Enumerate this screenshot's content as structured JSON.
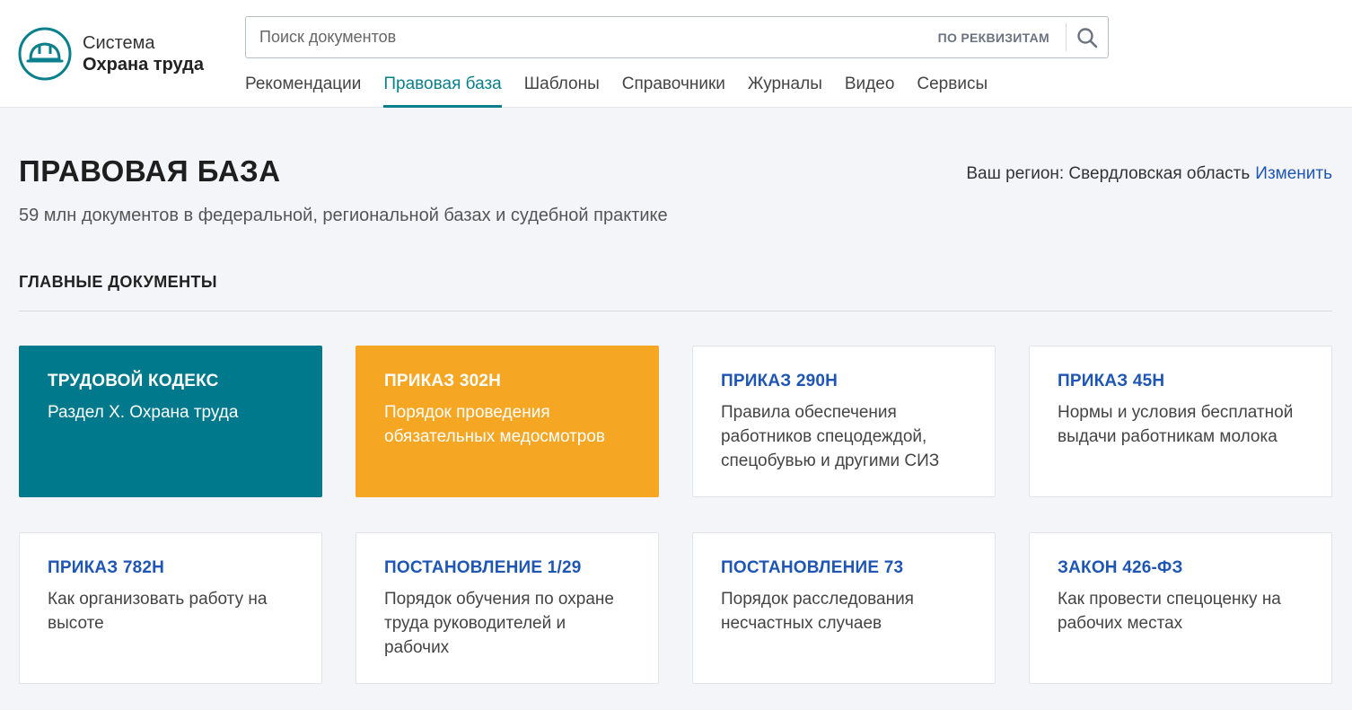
{
  "header": {
    "logo": {
      "line1": "Система",
      "line2": "Охрана труда"
    },
    "search": {
      "placeholder": "Поиск документов",
      "requisites_label": "ПО РЕКВИЗИТАМ",
      "button_icon": "search-icon"
    },
    "nav": [
      {
        "label": "Рекомендации",
        "active": false
      },
      {
        "label": "Правовая база",
        "active": true
      },
      {
        "label": "Шаблоны",
        "active": false
      },
      {
        "label": "Справочники",
        "active": false
      },
      {
        "label": "Журналы",
        "active": false
      },
      {
        "label": "Видео",
        "active": false
      },
      {
        "label": "Сервисы",
        "active": false
      }
    ]
  },
  "page": {
    "title": "ПРАВОВАЯ БАЗА",
    "subtitle": "59 млн документов в федеральной, региональной базах и судебной практике",
    "region_label": "Ваш регион: Свердловская область",
    "region_change": "Изменить",
    "section_title": "ГЛАВНЫЕ ДОКУМЕНТЫ"
  },
  "cards": [
    {
      "title": "ТРУДОВОЙ КОДЕКС",
      "desc": "Раздел X. Охрана труда"
    },
    {
      "title": "ПРИКАЗ 302Н",
      "desc": "Порядок проведения обязательных медосмотров"
    },
    {
      "title": "ПРИКАЗ 290Н",
      "desc": "Правила обеспечения работников спецодеждой, спецобувью и другими СИЗ"
    },
    {
      "title": "ПРИКАЗ 45Н",
      "desc": "Нормы и условия бесплатной выдачи работникам молока"
    },
    {
      "title": "ПРИКАЗ 782Н",
      "desc": "Как организовать работу на высоте"
    },
    {
      "title": "ПОСТАНОВЛЕНИЕ 1/29",
      "desc": "Порядок обучения по охране труда руководителей и рабочих"
    },
    {
      "title": "ПОСТАНОВЛЕНИЕ 73",
      "desc": "Порядок расследования несчастных случаев"
    },
    {
      "title": "ЗАКОН 426-ФЗ",
      "desc": "Как провести спецоценку на рабочих местах"
    }
  ],
  "colors": {
    "accent": "#0b7f8c",
    "link": "#1f56b3",
    "card_teal": "#00798c",
    "card_orange": "#f5a623",
    "background": "#f4f5f8"
  }
}
